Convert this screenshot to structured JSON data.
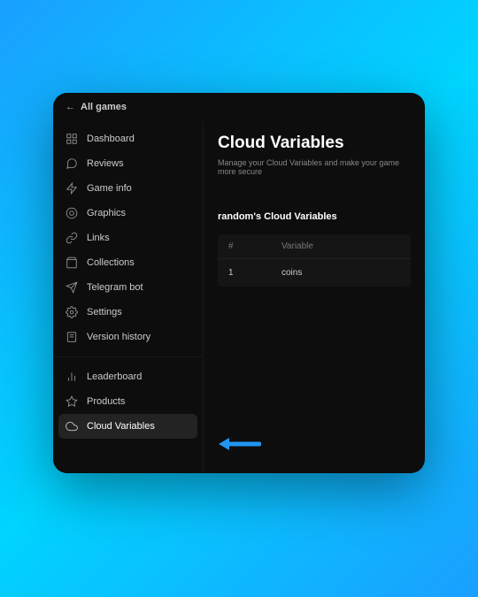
{
  "topBar": {
    "backLabel": "All games"
  },
  "sidebar": {
    "section1": [
      {
        "icon": "dashboard",
        "label": "Dashboard"
      },
      {
        "icon": "reviews",
        "label": "Reviews"
      },
      {
        "icon": "gameinfo",
        "label": "Game info"
      },
      {
        "icon": "graphics",
        "label": "Graphics"
      },
      {
        "icon": "links",
        "label": "Links"
      },
      {
        "icon": "collections",
        "label": "Collections"
      },
      {
        "icon": "telegram",
        "label": "Telegram bot"
      },
      {
        "icon": "settings",
        "label": "Settings"
      },
      {
        "icon": "version",
        "label": "Version history"
      }
    ],
    "section2": [
      {
        "icon": "leaderboard",
        "label": "Leaderboard"
      },
      {
        "icon": "products",
        "label": "Products"
      },
      {
        "icon": "cloud",
        "label": "Cloud Variables",
        "active": true
      }
    ]
  },
  "main": {
    "title": "Cloud Variables",
    "subtitle": "Manage your Cloud Variables and make your game more secure",
    "sectionTitle": "random's Cloud Variables",
    "table": {
      "headers": {
        "num": "#",
        "variable": "Variable"
      },
      "rows": [
        {
          "num": "1",
          "variable": "coins"
        }
      ]
    }
  }
}
